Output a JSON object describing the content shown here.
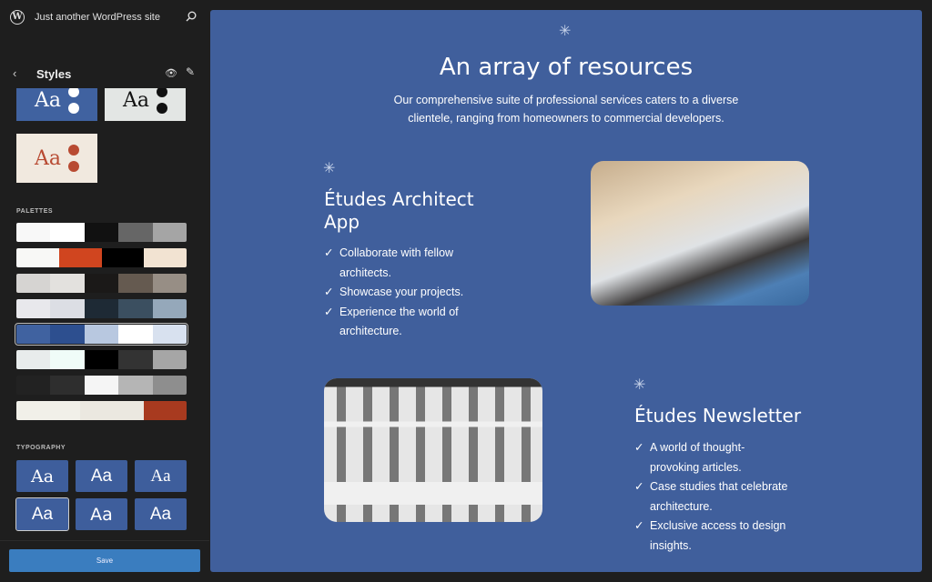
{
  "header": {
    "site_title": "Just another WordPress site",
    "logo_text": "W"
  },
  "panel": {
    "back_icon": "‹",
    "title": "Styles",
    "eye_icon": "👁",
    "edit_icon": "✎"
  },
  "variations": [
    {
      "label": "Aa",
      "bg": "#4062a0",
      "fg": "#ffffff",
      "dot": "#ffffff"
    },
    {
      "label": "Aa",
      "bg": "#e3e6e4",
      "fg": "#111111",
      "dot": "#111111"
    },
    {
      "label": "Aa",
      "bg": "#f1e9df",
      "fg": "#b84a32",
      "dot": "#b84a32"
    }
  ],
  "palettes_label": "PALETTES",
  "palettes": [
    [
      "#f8f8f8",
      "#ffffff",
      "#111111",
      "#666666",
      "#a5a5a5"
    ],
    [
      "#f8f8f6",
      "#d0451f",
      "#000000",
      "#f2e3d2"
    ],
    [
      "#d6d4d2",
      "#e3e1de",
      "#1b1918",
      "#655a50",
      "#978e85"
    ],
    [
      "#e8e8ec",
      "#dcdee4",
      "#1e2a35",
      "#3b4f60",
      "#95a8ba"
    ],
    [
      "#4062a0",
      "#2d4f8f",
      "#b8c8e0",
      "#ffffff",
      "#d8e1ef"
    ],
    [
      "#e8ecec",
      "#f0fcf8",
      "#000000",
      "#333333",
      "#a6a6a6"
    ],
    [
      "#222222",
      "#2e2e2e",
      "#f5f5f5",
      "#b5b5b5",
      "#8e8e8e"
    ],
    [
      "#f1f0e9",
      "#ebe8e0",
      "#a83a1f"
    ]
  ],
  "selected_palette": 4,
  "typography_label": "TYPOGRAPHY",
  "typography": [
    "Aa",
    "Aa",
    "Aa",
    "Aa",
    "Aa",
    "Aa"
  ],
  "selected_typography": 3,
  "save_label": "Save",
  "canvas": {
    "bg": "#405f9c",
    "asterisk": "✳",
    "title": "An array of resources",
    "subtitle": "Our comprehensive suite of professional services caters to a diverse clientele, ranging from homeowners to commercial developers.",
    "app": {
      "heading": "Études Architect App",
      "items": [
        "Collaborate with fellow architects.",
        "Showcase your projects.",
        "Experience the world of architecture."
      ]
    },
    "newsletter": {
      "heading": "Études Newsletter",
      "items": [
        "A world of thought-provoking articles.",
        "Case studies that celebrate architecture.",
        "Exclusive access to design insights."
      ]
    }
  }
}
